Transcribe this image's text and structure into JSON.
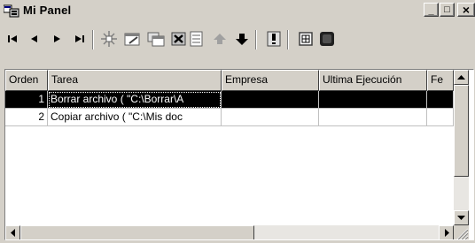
{
  "window": {
    "title": "Mi Panel"
  },
  "title_buttons": {
    "minimize": "_",
    "maximize": "□",
    "close": "×"
  },
  "toolbar": {
    "buttons": [
      {
        "name": "first-record-icon"
      },
      {
        "name": "previous-record-icon"
      },
      {
        "name": "next-record-icon"
      },
      {
        "name": "last-record-icon"
      },
      {
        "name": "new-task-icon"
      },
      {
        "name": "edit-task-icon"
      },
      {
        "name": "copy-task-icon"
      },
      {
        "name": "delete-task-icon"
      },
      {
        "name": "properties-icon"
      },
      {
        "name": "move-up-icon"
      },
      {
        "name": "move-down-icon"
      },
      {
        "name": "alert-icon"
      },
      {
        "name": "calendar-icon"
      },
      {
        "name": "stop-icon"
      }
    ]
  },
  "grid": {
    "columns": [
      "Orden",
      "Tarea",
      "Empresa",
      "Ultima Ejecución",
      "Fe"
    ],
    "rows": [
      {
        "orden": "1",
        "tarea": "Borrar archivo ( \"C:\\Borrar\\A",
        "empresa": "",
        "ultima": "",
        "fecha": "",
        "selected": true
      },
      {
        "orden": "2",
        "tarea": "Copiar archivo ( \"C:\\Mis doc",
        "empresa": "",
        "ultima": "",
        "fecha": "",
        "selected": false
      }
    ]
  },
  "colors": {
    "selection": "#000000",
    "face": "#d4d0c8"
  }
}
